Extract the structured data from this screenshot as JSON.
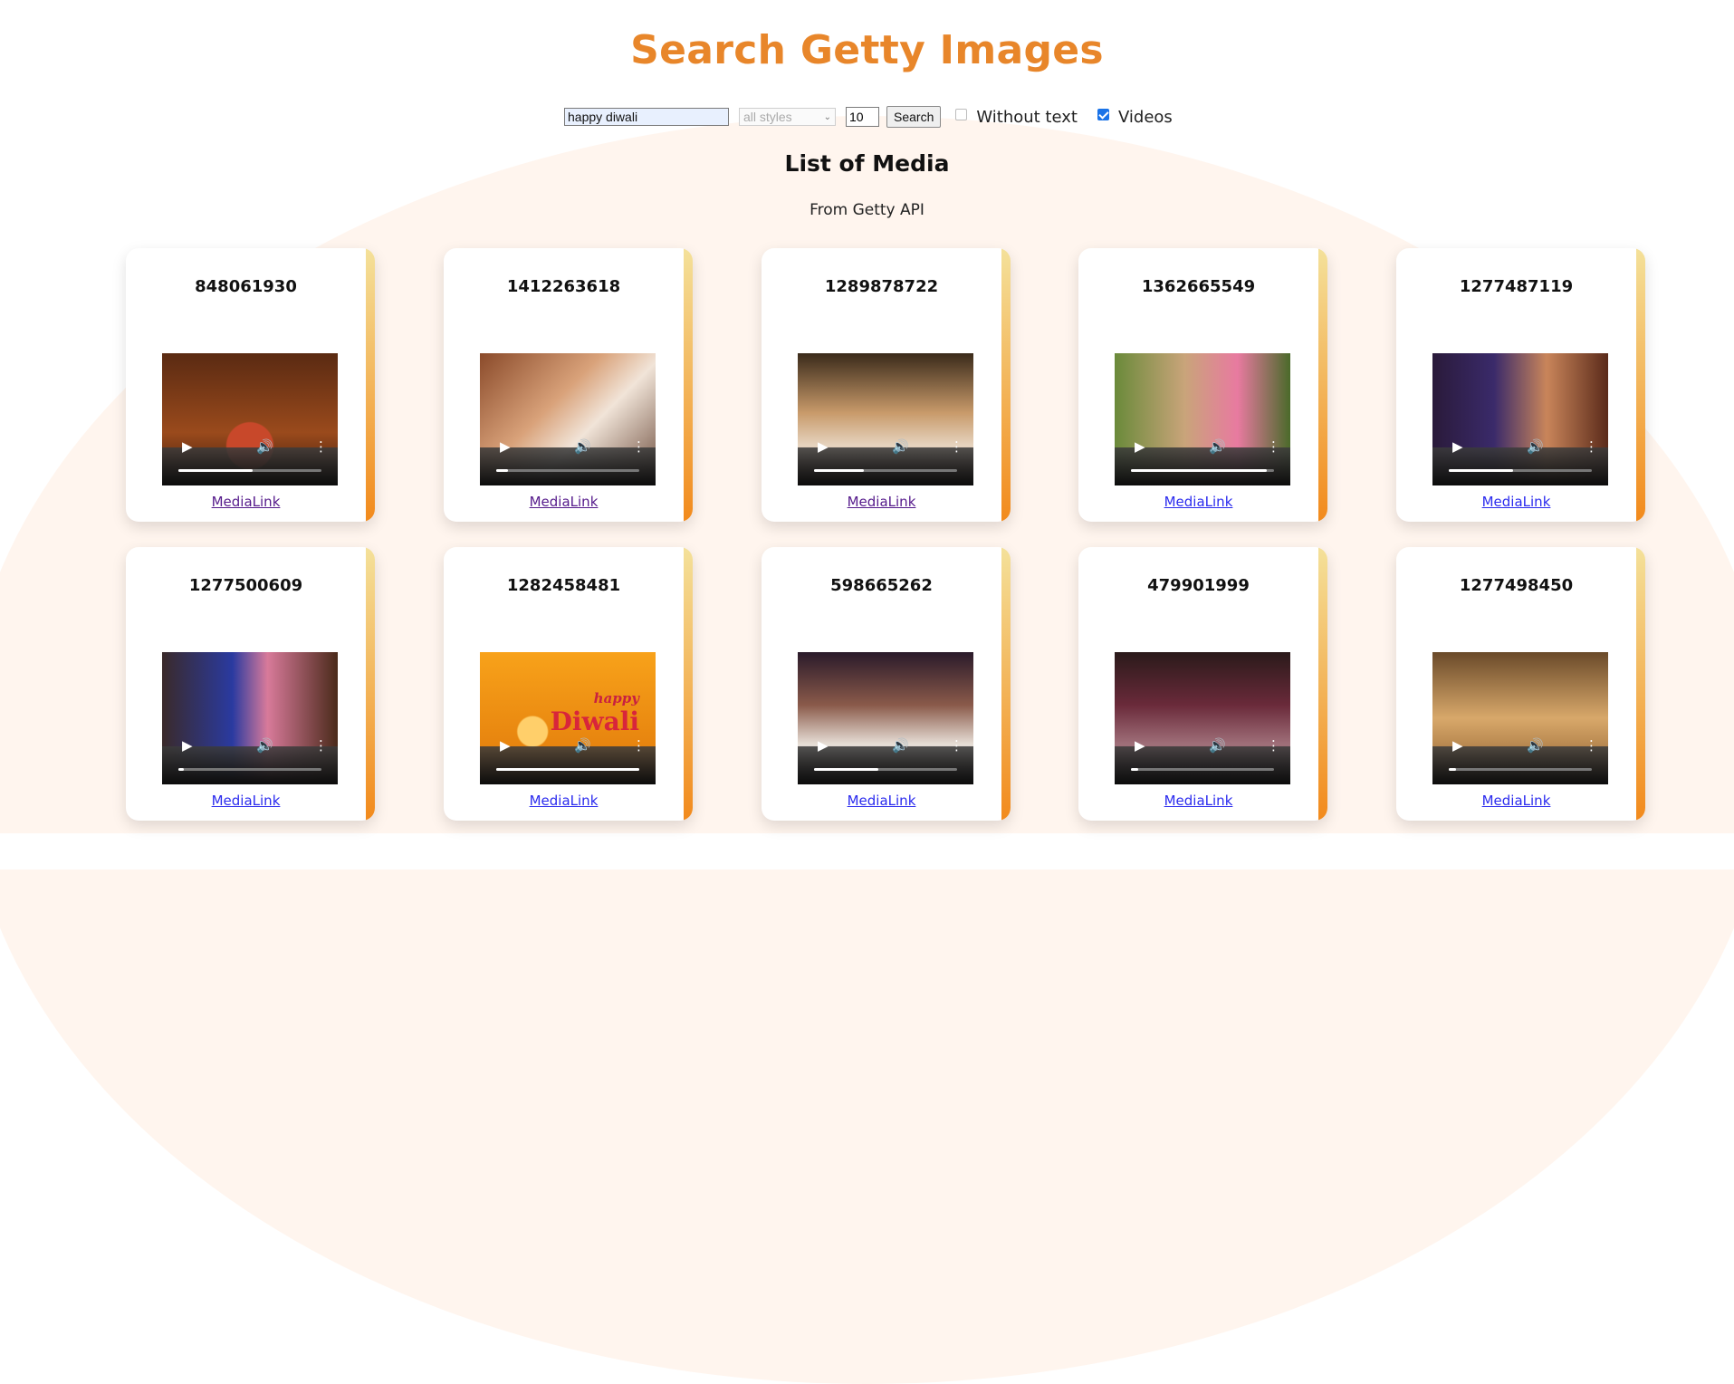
{
  "page": {
    "title": "Search Getty Images"
  },
  "search": {
    "query": "happy diwali",
    "style": "all styles",
    "count": "10",
    "button_label": "Search",
    "without_text_label": "Without text",
    "without_text_checked": false,
    "videos_label": "Videos",
    "videos_checked": true
  },
  "list": {
    "heading": "List of Media",
    "subheading": "From Getty API"
  },
  "colors": {
    "accent": "#e8862a",
    "stripe_top": "#f4e19a",
    "stripe_bottom": "#f28a1c",
    "link": "#2a2aee",
    "visited_link": "#551a8b"
  },
  "media": [
    {
      "id": "848061930",
      "link_label": "MediaLink",
      "visited": true,
      "progress": 0.52
    },
    {
      "id": "1412263618",
      "link_label": "MediaLink",
      "visited": true,
      "progress": 0.08
    },
    {
      "id": "1289878722",
      "link_label": "MediaLink",
      "visited": true,
      "progress": 0.35
    },
    {
      "id": "1362665549",
      "link_label": "MediaLink",
      "visited": false,
      "progress": 0.95
    },
    {
      "id": "1277487119",
      "link_label": "MediaLink",
      "visited": false,
      "progress": 0.45
    },
    {
      "id": "1277500609",
      "link_label": "MediaLink",
      "visited": false,
      "progress": 0.04
    },
    {
      "id": "1282458481",
      "link_label": "MediaLink",
      "visited": false,
      "progress": 1.0,
      "overlay_text": [
        "happy",
        "Diwali"
      ]
    },
    {
      "id": "598665262",
      "link_label": "MediaLink",
      "visited": false,
      "progress": 0.45
    },
    {
      "id": "479901999",
      "link_label": "MediaLink",
      "visited": false,
      "progress": 0.05
    },
    {
      "id": "1277498450",
      "link_label": "MediaLink",
      "visited": false,
      "progress": 0.05
    }
  ]
}
